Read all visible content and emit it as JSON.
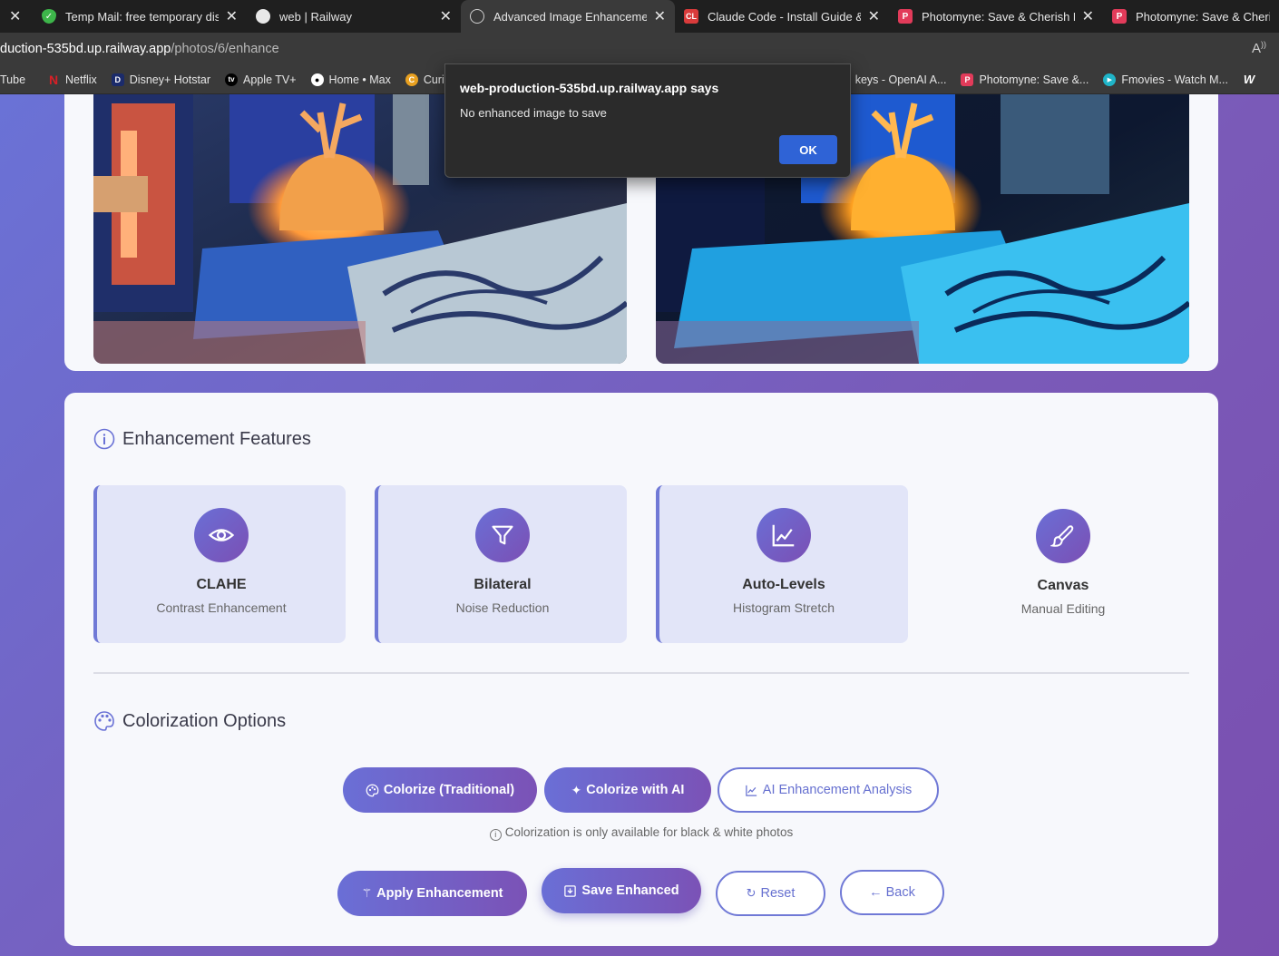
{
  "browser": {
    "tabs": [
      {
        "label": "",
        "fav_color": "",
        "fav_text": "",
        "active": false,
        "has_close": true
      },
      {
        "label": "Temp Mail: free temporary disposable",
        "fav_color": "#3db54a",
        "fav_text": "✓",
        "active": false
      },
      {
        "label": "web | Railway",
        "fav_color": "#e8e8e8",
        "fav_text": "",
        "active": false
      },
      {
        "label": "Advanced Image Enhancement - ",
        "fav_color": "#3a3a3a",
        "fav_text": "◎",
        "active": true
      },
      {
        "label": "Claude Code - Install Guide & Se",
        "fav_color": "#d93b3b",
        "fav_text": "CL",
        "active": false
      },
      {
        "label": "Photomyne: Save & Cherish Fami",
        "fav_color": "#e23b5a",
        "fav_text": "P",
        "active": false
      },
      {
        "label": "Photomyne: Save & Cherish Fa",
        "fav_color": "#e23b5a",
        "fav_text": "P",
        "active": false
      }
    ],
    "url_host": "duction-535bd.up.railway.app",
    "url_path": "/photos/6/enhance",
    "bookmarks": [
      {
        "label": "Tube",
        "icon_color": "",
        "icon_text": ""
      },
      {
        "label": "Netflix",
        "icon_color": "#d81f26",
        "icon_text": "N"
      },
      {
        "label": "Disney+ Hotstar",
        "icon_color": "#1b2b6b",
        "icon_text": "D"
      },
      {
        "label": "Apple TV+",
        "icon_color": "#000000",
        "icon_text": "tv"
      },
      {
        "label": "Home • Max",
        "icon_color": "#ffffff",
        "icon_text": "●"
      },
      {
        "label": "Curio",
        "icon_color": "#e8a020",
        "icon_text": "C"
      },
      {
        "label": "keys - OpenAI A...",
        "icon_color": "",
        "icon_text": ""
      },
      {
        "label": "Photomyne: Save &...",
        "icon_color": "#e23b5a",
        "icon_text": "P"
      },
      {
        "label": "Fmovies - Watch M...",
        "icon_color": "#1fb4c8",
        "icon_text": "▶"
      },
      {
        "label": "",
        "icon_color": "#3a3a3a",
        "icon_text": "W"
      }
    ]
  },
  "dialog": {
    "title": "web-production-535bd.up.railway.app says",
    "message": "No enhanced image to save",
    "ok_label": "OK"
  },
  "features": {
    "title": "Enhancement Features",
    "items": [
      {
        "name": "CLAHE",
        "desc": "Contrast Enhancement",
        "icon": "eye-icon",
        "highlight": true
      },
      {
        "name": "Bilateral",
        "desc": "Noise Reduction",
        "icon": "filter-icon",
        "highlight": true
      },
      {
        "name": "Auto-Levels",
        "desc": "Histogram Stretch",
        "icon": "chart-line-icon",
        "highlight": true
      },
      {
        "name": "Canvas",
        "desc": "Manual Editing",
        "icon": "brush-icon",
        "highlight": false
      }
    ]
  },
  "colorization": {
    "title": "Colorization Options",
    "buttons": {
      "traditional": "Colorize (Traditional)",
      "ai": "Colorize with AI",
      "analysis": "AI Enhancement Analysis"
    },
    "note": "Colorization is only available for black & white photos"
  },
  "actions": {
    "apply": "Apply Enhancement",
    "save": "Save Enhanced",
    "reset": "Reset",
    "back": "← Back"
  }
}
